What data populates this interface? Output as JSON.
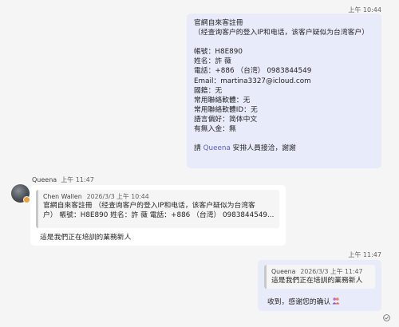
{
  "msg1": {
    "time": "上午 10:44",
    "lines": [
      "官網自來客註冊",
      "（经查询客户的登入IP和电话，该客户疑似为台湾客户）",
      "",
      "帳號：H8E890",
      "姓名：許 薇",
      "電話：+886 （台湾） 0983844549",
      "Email：martina3327@icloud.com",
      "國籍：无",
      "常用聯絡軟體：无",
      "常用聯絡軟體ID：无",
      "語言偏好：简体中文",
      "有無入金：無",
      ""
    ],
    "closing_pre": "請 ",
    "closing_mention": "Queena",
    "closing_post": " 安排人員接洽，謝謝"
  },
  "msg2": {
    "sender": "Queena",
    "time": "上午 11:47",
    "quote_author": "Chen Wallen",
    "quote_date": "2026/3/3 上午 10:44",
    "quote_line1": "官網自來客註冊 （经查询客户的登入IP和电话，该客户疑似为台湾客",
    "quote_line2": "户） 帳號：H8E890 姓名：許 薇 電話：+886 （台湾） 0983844549...",
    "text": "這是我們正在培訓的業務新人"
  },
  "msg3": {
    "time": "上午 11:47",
    "quote_author": "Queena",
    "quote_date": "2026/3/3 上午 11:47",
    "quote_text": "這是我們正在培訓的業務新人",
    "text": "收到，感谢您的确认"
  },
  "colors": {
    "my_bubble": "#e8ebfa",
    "their_bubble": "#ffffff",
    "mention": "#5b5fc7",
    "background": "#f5f5f5"
  },
  "icons": {
    "reaction": "people-emoji-icon",
    "read_receipt": "seen-check-icon",
    "presence": "away-presence-icon"
  }
}
